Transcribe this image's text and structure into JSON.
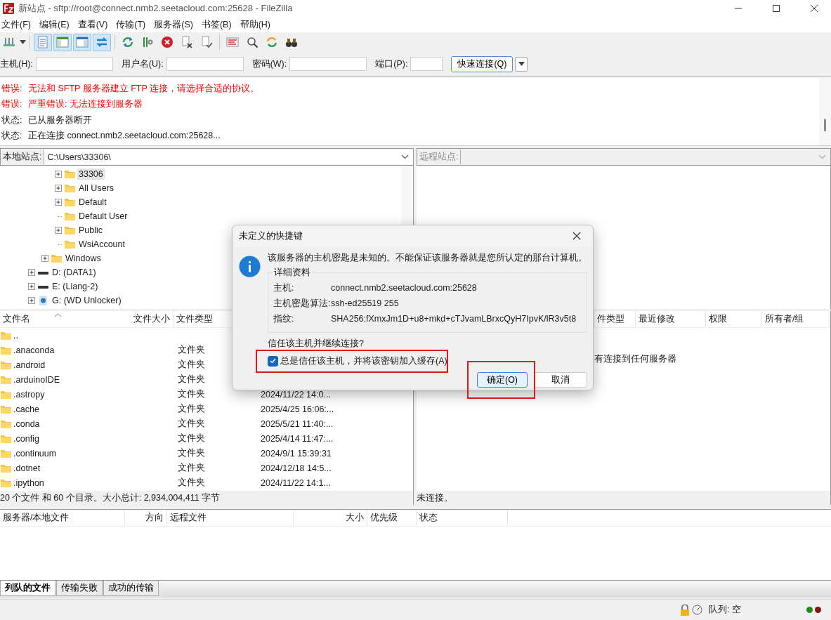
{
  "window": {
    "title": "新站点 - sftp://root@connect.nmb2.seetacloud.com:25628 - FileZilla"
  },
  "menu": [
    "文件(F)",
    "编辑(E)",
    "查看(V)",
    "传输(T)",
    "服务器(S)",
    "书签(B)",
    "帮助(H)"
  ],
  "toolbar": [
    {
      "on": false
    },
    {
      "on": true
    },
    {
      "on": true
    },
    {
      "on": true
    },
    {
      "on": true
    },
    {
      "on": false
    },
    {
      "on": false
    },
    {
      "on": false
    },
    {
      "on": false
    },
    {
      "on": false
    },
    {
      "on": false
    },
    {
      "on": false
    },
    {
      "on": false
    },
    {
      "on": false
    }
  ],
  "quickconnect": {
    "fields": [
      {
        "label": "主机(H):"
      },
      {
        "label": "用户名(U):"
      },
      {
        "label": "密码(W):"
      },
      {
        "label": "端口(P):"
      }
    ],
    "button": "快速连接(Q)"
  },
  "log": [
    {
      "kind": "error",
      "label": "错误:",
      "text": "无法和 SFTP 服务器建立 FTP 连接，请选择合适的协议。"
    },
    {
      "kind": "error",
      "label": "错误:",
      "text": "严重错误: 无法连接到服务器"
    },
    {
      "kind": "status",
      "label": "状态:",
      "text": "已从服务器断开"
    },
    {
      "kind": "status",
      "label": "状态:",
      "text": "正在连接 connect.nmb2.seetacloud.com:25628..."
    }
  ],
  "local": {
    "label": "本地站点:",
    "path": "C:\\Users\\33306\\",
    "tree": [
      {
        "children": [
          {
            "children": [
              {
                "label": "33306",
                "kind": "folder",
                "expandable": true,
                "selected": true
              },
              {
                "label": "All Users",
                "kind": "folder",
                "expandable": true,
                "selected": false
              },
              {
                "label": "Default",
                "kind": "folder",
                "expandable": true,
                "selected": false
              },
              {
                "label": "Default User",
                "kind": "folder",
                "expandable": false,
                "selected": false
              },
              {
                "label": "Public",
                "kind": "folder",
                "expandable": true,
                "selected": false
              },
              {
                "label": "WsiAccount",
                "kind": "folder",
                "expandable": false,
                "selected": false
              }
            ]
          },
          {
            "label": "Windows",
            "kind": "folder",
            "expandable": true,
            "selected": false
          }
        ]
      },
      {
        "label": "D: (DATA1)",
        "kind": "drive",
        "expandable": true,
        "selected": false
      },
      {
        "label": "E: (Liang-2)",
        "kind": "drive",
        "expandable": true,
        "selected": false
      },
      {
        "label": "G: (WD Unlocker)",
        "kind": "usb",
        "expandable": true,
        "selected": false
      }
    ],
    "columns": [
      "文件名",
      "文件大小",
      "文件类型"
    ],
    "rows": [
      {
        "name": ".."
      },
      {
        "name": ".anaconda",
        "type": "文件夹"
      },
      {
        "name": ".android",
        "type": "文件夹"
      },
      {
        "name": ".arduinoIDE",
        "type": "文件夹"
      },
      {
        "name": ".astropy",
        "type": "文件夹",
        "modified": "2024/11/22 14:0..."
      },
      {
        "name": ".cache",
        "type": "文件夹",
        "modified": "2025/4/25 16:06:..."
      },
      {
        "name": ".conda",
        "type": "文件夹",
        "modified": "2025/5/21 11:40:..."
      },
      {
        "name": ".config",
        "type": "文件夹",
        "modified": "2025/4/14 11:47:..."
      },
      {
        "name": ".continuum",
        "type": "文件夹",
        "modified": "2024/9/1 15:39:31"
      },
      {
        "name": ".dotnet",
        "type": "文件夹",
        "modified": "2024/12/18 14:5..."
      },
      {
        "name": ".ipython",
        "type": "文件夹",
        "modified": "2024/11/22 14:1..."
      }
    ],
    "status": "20 个文件 和 60 个目录。大小总计: 2,934,004,411 字节"
  },
  "remote": {
    "label": "远程站点:",
    "columns": [
      "件类型",
      "最近修改",
      "权限",
      "所有者/组"
    ],
    "message": "有连接到任何服务器",
    "status": "未连接。"
  },
  "queue": {
    "columns": [
      "服务器/本地文件",
      "方向",
      "远程文件",
      "大小",
      "优先级",
      "状态"
    ],
    "tabs": [
      {
        "label": "列队的文件",
        "selected": true
      },
      {
        "label": "传输失败",
        "selected": false
      },
      {
        "label": "成功的传输",
        "selected": false
      }
    ]
  },
  "statusbar": {
    "queue": "队列: 空",
    "lights": [
      {
        "color": "#1f8a1f"
      },
      {
        "color": "#8a1414"
      }
    ]
  },
  "dialog": {
    "title": "未定义的快捷键",
    "message": "该服务器的主机密匙是未知的。不能保证该服务器就是您所认定的那台计算机。",
    "group": "详细资料",
    "details": [
      {
        "label": "主机:",
        "value": "connect.nmb2.seetacloud.com:25628"
      },
      {
        "label": "主机密匙算法:",
        "value": "ssh-ed25519 255"
      },
      {
        "label": "指纹:",
        "value": "SHA256:fXmxJm1D+u8+mkd+cTJvamLBrxcQyH7IpvK/lR3v5t8"
      }
    ],
    "question": "信任该主机并继续连接?",
    "trust": {
      "label": "总是信任该主机，并将该密钥加入缓存(A)",
      "checked": true
    },
    "buttons": [
      {
        "label": "确定(O)",
        "kind": "primary"
      },
      {
        "label": "取消",
        "kind": "default"
      }
    ]
  }
}
